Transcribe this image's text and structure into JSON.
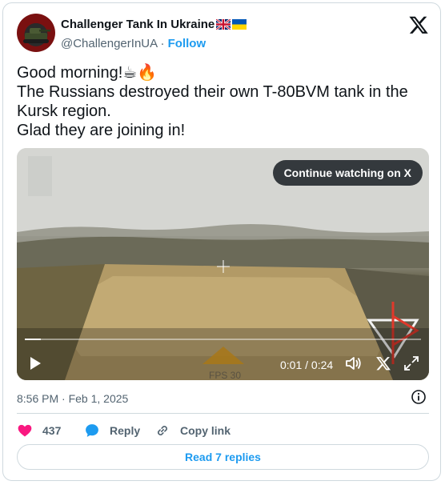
{
  "author": {
    "name": "Challenger Tank In Ukraine",
    "handle": "@ChallengerInUA",
    "separator": " · ",
    "follow_label": "Follow"
  },
  "tweet": {
    "text": "Good morning!☕🔥\nThe Russians destroyed their own T-80BVM tank in the Kursk region.\nGlad they are joining in!"
  },
  "video": {
    "continue_label": "Continue watching on X",
    "time": "0:01 / 0:24",
    "progress": 0.04,
    "overlay_text": "FPS 30"
  },
  "meta": {
    "timestamp": "8:56 PM · Feb 1, 2025"
  },
  "actions": {
    "like_count": "437",
    "reply_label": "Reply",
    "copy_label": "Copy link"
  },
  "read_replies_label": "Read 7 replies",
  "colors": {
    "accent": "#1d9bf0",
    "like": "#f91880",
    "muted": "#536471"
  }
}
